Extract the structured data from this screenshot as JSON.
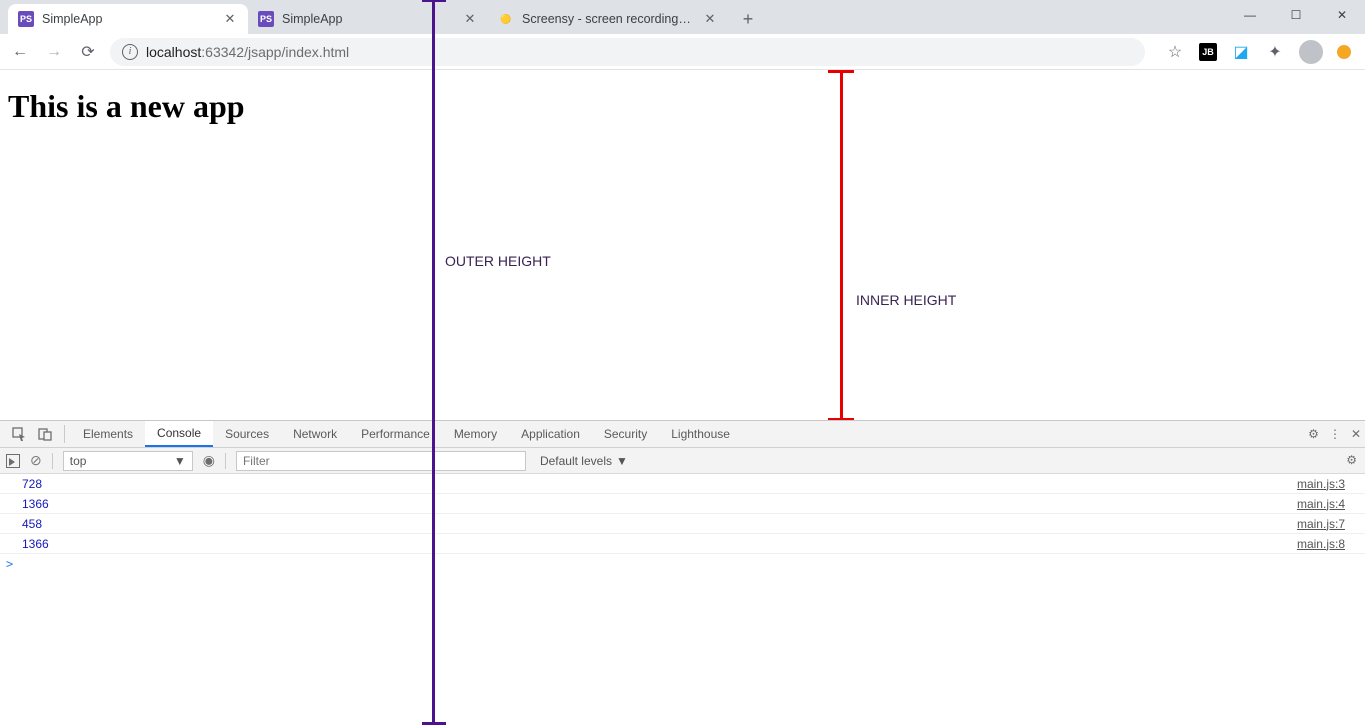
{
  "browser": {
    "tabs": [
      {
        "title": "SimpleApp",
        "active": true,
        "favicon": "PS"
      },
      {
        "title": "SimpleApp",
        "active": false,
        "favicon": "PS"
      },
      {
        "title": "Screensy - screen recording - Chr",
        "active": false,
        "favicon": "generic"
      }
    ],
    "url_host": "localhost",
    "url_port": ":63342",
    "url_path": "/jsapp/index.html"
  },
  "page": {
    "heading": "This is a new app",
    "outer_label": "OUTER HEIGHT",
    "inner_label": "INNER HEIGHT"
  },
  "devtools": {
    "panel_tabs": [
      "Elements",
      "Console",
      "Sources",
      "Network",
      "Performance",
      "Memory",
      "Application",
      "Security",
      "Lighthouse"
    ],
    "active_panel": "Console",
    "context": "top",
    "filter_placeholder": "Filter",
    "levels_label": "Default levels",
    "console_rows": [
      {
        "value": "728",
        "source": "main.js:3"
      },
      {
        "value": "1366",
        "source": "main.js:4"
      },
      {
        "value": "458",
        "source": "main.js:7"
      },
      {
        "value": "1366",
        "source": "main.js:8"
      }
    ],
    "prompt": ">"
  }
}
